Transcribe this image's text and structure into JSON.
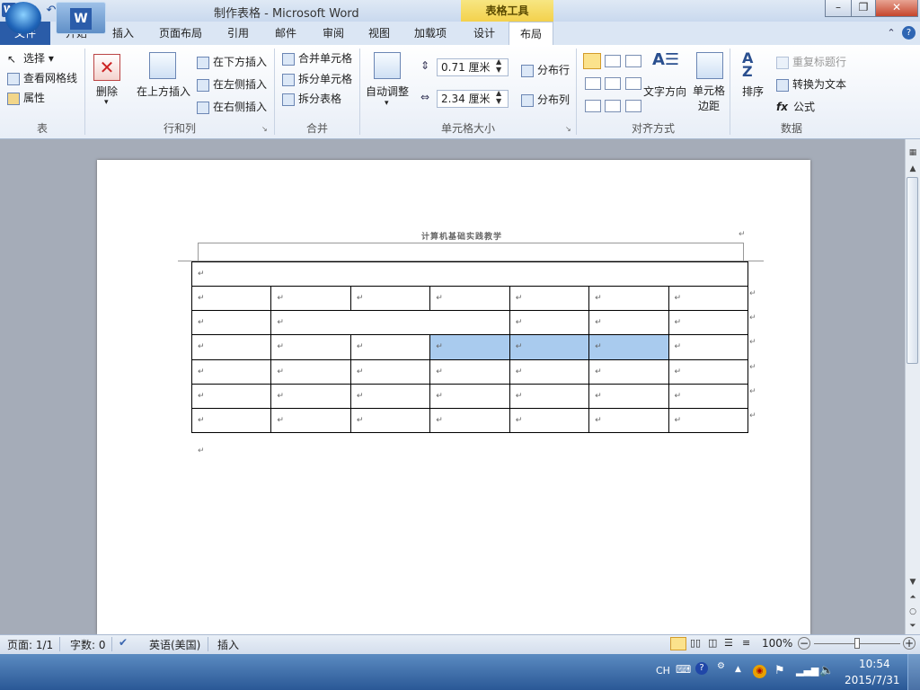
{
  "window": {
    "title": "制作表格 - Microsoft Word",
    "app_icon": "W",
    "contextual_tab": "表格工具",
    "controls": [
      "minimize-icon",
      "maximize-icon",
      "close-icon"
    ]
  },
  "quick_access": [
    "save-icon",
    "undo-icon",
    "redo-icon",
    "customize-icon"
  ],
  "tabs": [
    "文件",
    "开始",
    "插入",
    "页面布局",
    "引用",
    "邮件",
    "审阅",
    "视图",
    "加载项",
    "设计",
    "布局"
  ],
  "ribbon": {
    "table_group": {
      "label": "表",
      "items": [
        "选择",
        "查看网格线",
        "属性"
      ]
    },
    "rows_cols_group": {
      "label": "行和列",
      "delete": "删除",
      "insert_above": "在上方插入",
      "insert_below": "在下方插入",
      "insert_left": "在左侧插入",
      "insert_right": "在右侧插入"
    },
    "merge_group": {
      "label": "合并",
      "items": [
        "合并单元格",
        "拆分单元格",
        "拆分表格"
      ]
    },
    "cell_size_group": {
      "label": "单元格大小",
      "autofit": "自动调整",
      "height_value": "0.71 厘米",
      "width_value": "2.34 厘米",
      "distribute_rows": "分布行",
      "distribute_cols": "分布列"
    },
    "alignment_group": {
      "label": "对齐方式",
      "text_direction": "文字方向",
      "cell_margins": "单元格边距"
    },
    "data_group": {
      "label": "数据",
      "sort": "排序",
      "repeat_header": "重复标题行",
      "convert_text": "转换为文本",
      "formula": "公式"
    }
  },
  "document": {
    "title": "计算机基础实践教学",
    "paragraph_mark": "↵",
    "table": {
      "rows": [
        {
          "cells": [
            {
              "span": 7,
              "text": "↵",
              "selected": false
            }
          ]
        },
        {
          "cells": [
            {
              "span": 1,
              "text": "↵",
              "selected": false
            },
            {
              "span": 1,
              "text": "↵",
              "selected": false
            },
            {
              "span": 1,
              "text": "↵",
              "selected": false
            },
            {
              "span": 1,
              "text": "↵",
              "selected": false
            },
            {
              "span": 1,
              "text": "↵",
              "selected": false
            },
            {
              "span": 1,
              "text": "↵",
              "selected": false
            },
            {
              "span": 1,
              "text": "↵",
              "selected": false
            }
          ]
        },
        {
          "cells": [
            {
              "span": 1,
              "text": "↵",
              "selected": false
            },
            {
              "span": 3,
              "text": "↵",
              "selected": false
            },
            {
              "span": 1,
              "text": "↵",
              "selected": false
            },
            {
              "span": 1,
              "text": "↵",
              "selected": false
            },
            {
              "span": 1,
              "text": "↵",
              "selected": false
            }
          ]
        },
        {
          "cells": [
            {
              "span": 1,
              "text": "↵",
              "selected": false
            },
            {
              "span": 1,
              "text": "↵",
              "selected": false
            },
            {
              "span": 1,
              "text": "↵",
              "selected": false
            },
            {
              "span": 1,
              "text": "↵",
              "selected": true
            },
            {
              "span": 1,
              "text": "↵",
              "selected": true
            },
            {
              "span": 1,
              "text": "↵",
              "selected": true
            },
            {
              "span": 1,
              "text": "↵",
              "selected": false
            }
          ]
        },
        {
          "cells": [
            {
              "span": 1,
              "text": "↵",
              "selected": false
            },
            {
              "span": 1,
              "text": "↵",
              "selected": false
            },
            {
              "span": 1,
              "text": "↵",
              "selected": false
            },
            {
              "span": 1,
              "text": "↵",
              "selected": false
            },
            {
              "span": 1,
              "text": "↵",
              "selected": false
            },
            {
              "span": 1,
              "text": "↵",
              "selected": false
            },
            {
              "span": 1,
              "text": "↵",
              "selected": false
            }
          ]
        },
        {
          "cells": [
            {
              "span": 1,
              "text": "↵",
              "selected": false
            },
            {
              "span": 1,
              "text": "↵",
              "selected": false
            },
            {
              "span": 1,
              "text": "↵",
              "selected": false
            },
            {
              "span": 1,
              "text": "↵",
              "selected": false
            },
            {
              "span": 1,
              "text": "↵",
              "selected": false
            },
            {
              "span": 1,
              "text": "↵",
              "selected": false
            },
            {
              "span": 1,
              "text": "↵",
              "selected": false
            }
          ]
        },
        {
          "cells": [
            {
              "span": 1,
              "text": "↵",
              "selected": false
            },
            {
              "span": 1,
              "text": "↵",
              "selected": false
            },
            {
              "span": 1,
              "text": "↵",
              "selected": false
            },
            {
              "span": 1,
              "text": "↵",
              "selected": false
            },
            {
              "span": 1,
              "text": "↵",
              "selected": false
            },
            {
              "span": 1,
              "text": "↵",
              "selected": false
            },
            {
              "span": 1,
              "text": "↵",
              "selected": false
            }
          ]
        }
      ]
    }
  },
  "statusbar": {
    "page": "页面: 1/1",
    "words": "字数: 0",
    "language": "英语(美国)",
    "mode": "插入",
    "zoom": "100%",
    "zoom_level": 100
  },
  "taskbar": {
    "ime": "CH",
    "time": "10:54",
    "date": "2015/7/31"
  },
  "colors": {
    "selection": "#a9cbee",
    "file_tab": "#2a5ca8",
    "contextual": "#f3d14c"
  }
}
